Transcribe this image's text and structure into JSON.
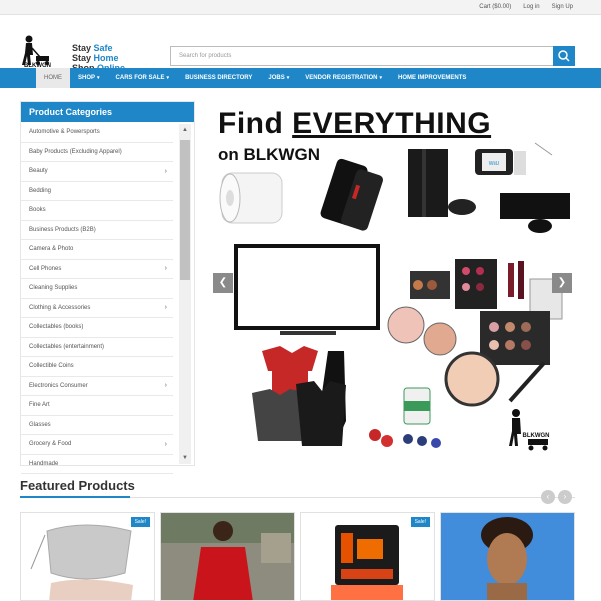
{
  "topbar": {
    "cart": "Cart ($0.00)",
    "login": "Log in",
    "signup": "Sign Up"
  },
  "logo": {
    "brand": "BLKWGN",
    "tagline_line1_a": "Stay",
    "tagline_line1_b": "Safe",
    "tagline_line2_a": "Stay",
    "tagline_line2_b": "Home",
    "tagline_line3_a": "Shop",
    "tagline_line3_b": "Online"
  },
  "search": {
    "placeholder": "Search for products"
  },
  "nav": [
    {
      "label": "HOME",
      "caret": ""
    },
    {
      "label": "SHOP",
      "caret": "▾"
    },
    {
      "label": "CARS FOR SALE",
      "caret": "▾"
    },
    {
      "label": "BUSINESS DIRECTORY",
      "caret": ""
    },
    {
      "label": "JOBS",
      "caret": "▾"
    },
    {
      "label": "VENDOR REGISTRATION",
      "caret": "▾"
    },
    {
      "label": "HOME IMPROVEMENTS",
      "caret": ""
    }
  ],
  "categories": {
    "title": "Product Categories",
    "items": [
      {
        "label": "Automotive & Powersports",
        "arrow": ""
      },
      {
        "label": "Baby Products (Excluding Apparel)",
        "arrow": ""
      },
      {
        "label": "Beauty",
        "arrow": "›"
      },
      {
        "label": "Bedding",
        "arrow": ""
      },
      {
        "label": "Books",
        "arrow": ""
      },
      {
        "label": "Business Products (B2B)",
        "arrow": ""
      },
      {
        "label": "Camera & Photo",
        "arrow": ""
      },
      {
        "label": "Cell Phones",
        "arrow": "›"
      },
      {
        "label": "Cleaning Supplies",
        "arrow": ""
      },
      {
        "label": "Clothing & Accessories",
        "arrow": "›"
      },
      {
        "label": "Collectables (books)",
        "arrow": ""
      },
      {
        "label": "Collectables (entertainment)",
        "arrow": ""
      },
      {
        "label": "Collectible Coins",
        "arrow": ""
      },
      {
        "label": "Electronics Consumer",
        "arrow": "›"
      },
      {
        "label": "Fine Art",
        "arrow": ""
      },
      {
        "label": "Glasses",
        "arrow": ""
      },
      {
        "label": "Grocery & Food",
        "arrow": "›"
      },
      {
        "label": "Handmade",
        "arrow": ""
      }
    ]
  },
  "banner": {
    "title_a": "Find",
    "title_b": "EVERYTHING",
    "subtitle": "on BLKWGN",
    "watermark": "BLKWGN",
    "wiiu": "WiiU"
  },
  "featured": {
    "title": "Featured Products",
    "sale": "Sale!"
  },
  "colors": {
    "accent": "#1f86c7",
    "nav_bg": "#1f86c7"
  }
}
